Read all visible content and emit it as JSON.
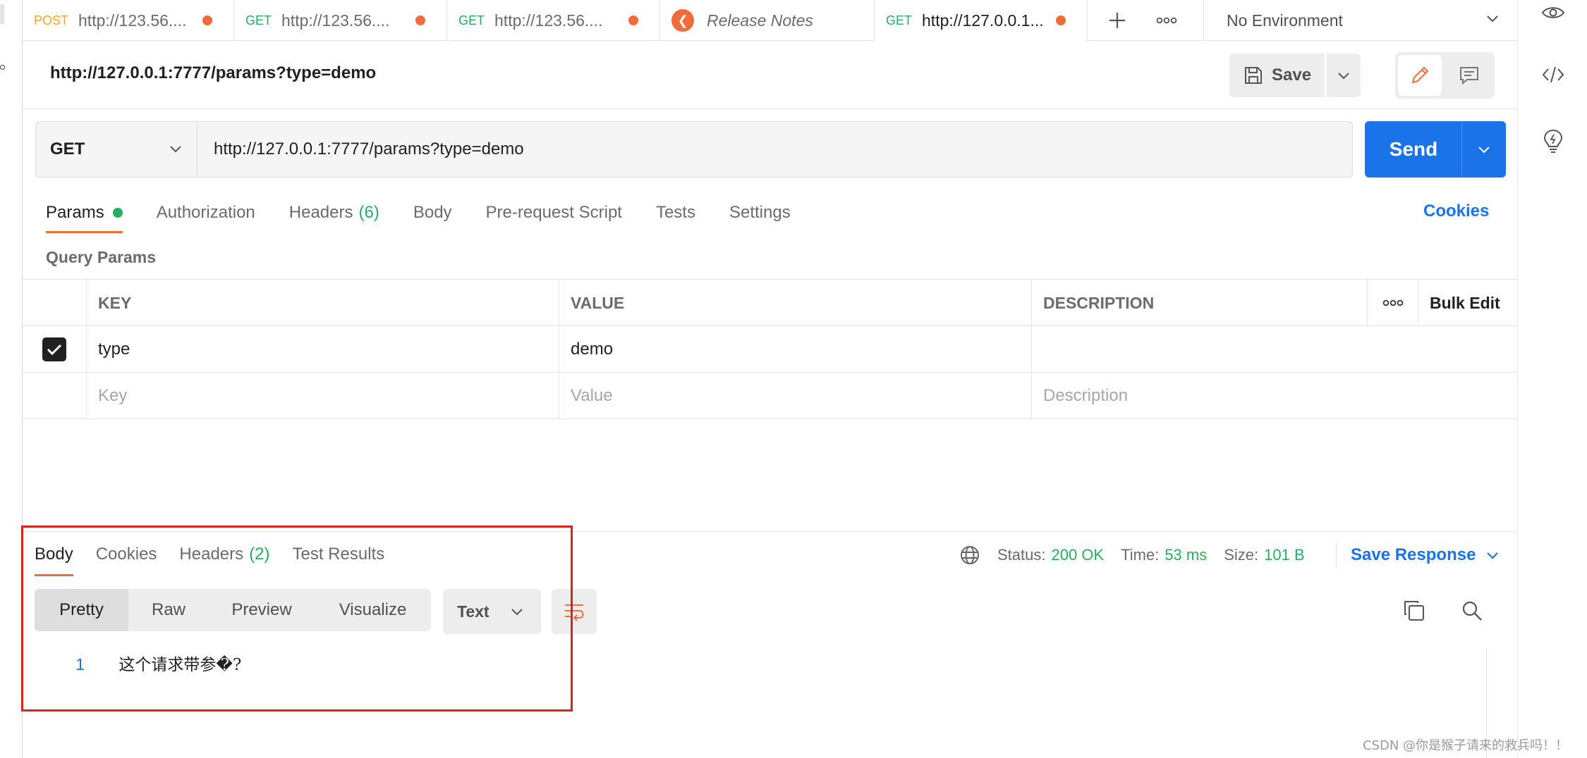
{
  "tabs": [
    {
      "method": "POST",
      "label": "http://123.56....",
      "unsaved": true
    },
    {
      "method": "GET",
      "label": "http://123.56....",
      "unsaved": true
    },
    {
      "method": "GET",
      "label": "http://123.56....",
      "unsaved": true
    },
    {
      "method": "",
      "label": "Release Notes",
      "unsaved": false
    },
    {
      "method": "GET",
      "label": "http://127.0.0.1...",
      "unsaved": true
    }
  ],
  "environment": "No Environment",
  "request": {
    "title": "http://127.0.0.1:7777/params?type=demo",
    "method": "GET",
    "url": "http://127.0.0.1:7777/params?type=demo"
  },
  "toolbar": {
    "save_label": "Save",
    "send_label": "Send"
  },
  "request_tabs": {
    "params": "Params",
    "authorization": "Authorization",
    "headers": "Headers",
    "headers_count": "(6)",
    "body": "Body",
    "pre_request": "Pre-request Script",
    "tests": "Tests",
    "settings": "Settings",
    "cookies": "Cookies"
  },
  "query_params": {
    "label": "Query Params",
    "columns": {
      "key": "KEY",
      "value": "VALUE",
      "description": "DESCRIPTION",
      "bulk_edit": "Bulk Edit"
    },
    "rows": [
      {
        "checked": true,
        "key": "type",
        "value": "demo",
        "description": ""
      }
    ],
    "placeholders": {
      "key": "Key",
      "value": "Value",
      "description": "Description"
    }
  },
  "response": {
    "tabs": {
      "body": "Body",
      "cookies": "Cookies",
      "headers": "Headers",
      "headers_count": "(2)",
      "test_results": "Test Results"
    },
    "status_label": "Status:",
    "status_value": "200 OK",
    "time_label": "Time:",
    "time_value": "53 ms",
    "size_label": "Size:",
    "size_value": "101 B",
    "save_response": "Save Response",
    "views": [
      "Pretty",
      "Raw",
      "Preview",
      "Visualize"
    ],
    "format": "Text",
    "body_lines": [
      {
        "n": "1",
        "text": "这个请求带参�?"
      }
    ]
  },
  "watermark": "CSDN @你是猴子请来的救兵吗！！",
  "colors": {
    "accent_orange": "#f26b3a",
    "send_blue": "#1a73e8",
    "success_green": "#27ae60",
    "highlight_red": "#d9231d"
  }
}
